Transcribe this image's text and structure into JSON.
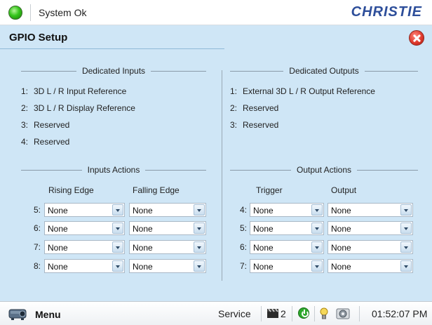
{
  "status": {
    "text": "System Ok"
  },
  "brand": {
    "logo_text": "CHRISTIE"
  },
  "page": {
    "title": "GPIO Setup"
  },
  "dedicated_inputs": {
    "heading": "Dedicated Inputs",
    "items": [
      {
        "num": "1:",
        "label": "3D L / R Input Reference"
      },
      {
        "num": "2:",
        "label": "3D L / R Display Reference"
      },
      {
        "num": "3:",
        "label": "Reserved"
      },
      {
        "num": "4:",
        "label": "Reserved"
      }
    ]
  },
  "dedicated_outputs": {
    "heading": "Dedicated Outputs",
    "items": [
      {
        "num": "1:",
        "label": "External 3D L / R Output Reference"
      },
      {
        "num": "2:",
        "label": "Reserved"
      },
      {
        "num": "3:",
        "label": "Reserved"
      }
    ]
  },
  "inputs_actions": {
    "heading": "Inputs Actions",
    "col1": "Rising Edge",
    "col2": "Falling Edge",
    "rows": [
      {
        "num": "5:",
        "rising": "None",
        "falling": "None"
      },
      {
        "num": "6:",
        "rising": "None",
        "falling": "None"
      },
      {
        "num": "7:",
        "rising": "None",
        "falling": "None"
      },
      {
        "num": "8:",
        "rising": "None",
        "falling": "None"
      }
    ]
  },
  "output_actions": {
    "heading": "Output Actions",
    "col1": "Trigger",
    "col2": "Output",
    "rows": [
      {
        "num": "4:",
        "trigger": "None",
        "output": "None"
      },
      {
        "num": "5:",
        "trigger": "None",
        "output": "None"
      },
      {
        "num": "6:",
        "trigger": "None",
        "output": "None"
      },
      {
        "num": "7:",
        "trigger": "None",
        "output": "None"
      }
    ]
  },
  "bottombar": {
    "menu_label": "Menu",
    "service_label": "Service",
    "channel_count": "2",
    "clock": "01:52:07 PM"
  },
  "icons": [
    "status-led-icon",
    "close-icon",
    "projector-icon",
    "clapper-icon",
    "power-icon",
    "lamp-icon",
    "mechanism-icon",
    "dropdown-arrow-icon"
  ],
  "colors": {
    "background": "#cfe6f6",
    "brand": "#2d4e9a",
    "status_ok": "#35c51b",
    "close": "#e03a2d"
  }
}
